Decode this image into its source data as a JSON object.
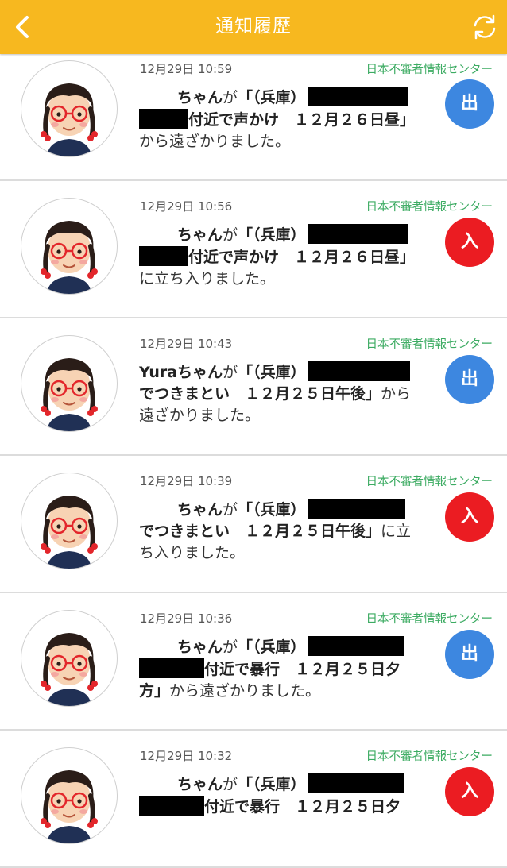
{
  "header": {
    "title": "通知履歴",
    "back_icon": "chevron-left-icon",
    "refresh_icon": "refresh-icon",
    "background": "#f7b81f"
  },
  "colors": {
    "out_badge": "#3d87e0",
    "in_badge": "#eb1c22",
    "source_text": "#3cab62"
  },
  "notifications": [
    {
      "time": "12月29日 10:59",
      "source": "日本不審者情報センター",
      "badge": "出",
      "badge_type": "out",
      "name_suffix": "ちゃん",
      "ga": "が",
      "bracket_pref": "「（兵庫）",
      "line2_tail": "付近で声かけ　１２月２６日昼」",
      "line3": "から遠ざかりました。"
    },
    {
      "time": "12月29日 10:56",
      "source": "日本不審者情報センター",
      "badge": "入",
      "badge_type": "in",
      "name_suffix": "ちゃん",
      "ga": "が",
      "bracket_pref": "「（兵庫）",
      "line2_tail": "付近で声かけ　１２月２６日昼」",
      "line3": "に立ち入りました。"
    },
    {
      "time": "12月29日 10:43",
      "source": "日本不審者情報センター",
      "badge": "出",
      "badge_type": "out",
      "name_suffix": "Yuraちゃん",
      "ga": "が",
      "bracket_pref": "「（兵庫）",
      "line2_bold": "でつきまとい　１２月２５日午後」",
      "line2_plain": "から",
      "line3": "遠ざかりました。"
    },
    {
      "time": "12月29日 10:39",
      "source": "日本不審者情報センター",
      "badge": "入",
      "badge_type": "in",
      "name_suffix": "ちゃん",
      "ga": "が",
      "bracket_pref": "「（兵庫）",
      "line2_bold": "でつきまとい　１２月２５日午後」",
      "line2_plain": "に立",
      "line3": "ち入りました。"
    },
    {
      "time": "12月29日 10:36",
      "source": "日本不審者情報センター",
      "badge": "出",
      "badge_type": "out",
      "name_suffix": "ちゃん",
      "ga": "が",
      "bracket_pref": "「（兵庫）",
      "line2_tail": "付近で暴行　１２月２５日夕",
      "line3_bold": "方」",
      "line3_plain": "から遠ざかりました。"
    },
    {
      "time": "12月29日 10:32",
      "source": "日本不審者情報センター",
      "badge": "入",
      "badge_type": "in",
      "name_suffix": "ちゃん",
      "ga": "が",
      "bracket_pref": "「（兵庫）",
      "line2_tail": "付近で暴行　１２月２５日夕"
    }
  ]
}
